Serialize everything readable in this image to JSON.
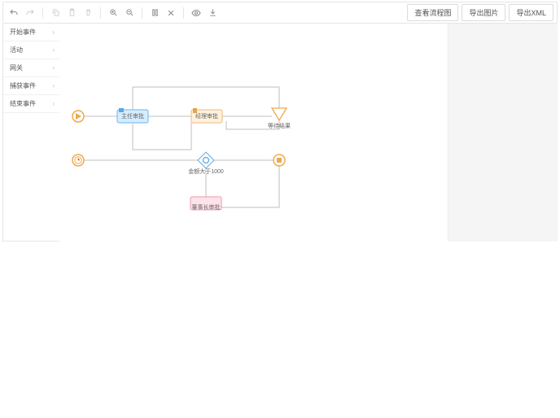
{
  "toolbar": {
    "buttons": {
      "view_flow": "查看流程图",
      "export_img": "导出图片",
      "export_xml": "导出XML"
    }
  },
  "sidebar": {
    "items": [
      {
        "label": "开始事件"
      },
      {
        "label": "活动"
      },
      {
        "label": "网关"
      },
      {
        "label": "捕获事件"
      },
      {
        "label": "结束事件"
      }
    ]
  },
  "diagram": {
    "nodes": {
      "start": {
        "type": "start"
      },
      "timer": {
        "type": "timer"
      },
      "task1": {
        "label": "主任审批",
        "fill": "#d4edff",
        "stroke": "#6fb4e8"
      },
      "task2": {
        "label": "经理审批",
        "fill": "#fff2dd",
        "stroke": "#e8b87a"
      },
      "task3": {
        "label": "董事长审批",
        "fill": "#ffe2ea",
        "stroke": "#e89ab3"
      },
      "gateway": {
        "label": "金额大于1000"
      },
      "wait": {
        "label": "等待结果"
      },
      "end": {
        "type": "end"
      }
    }
  }
}
